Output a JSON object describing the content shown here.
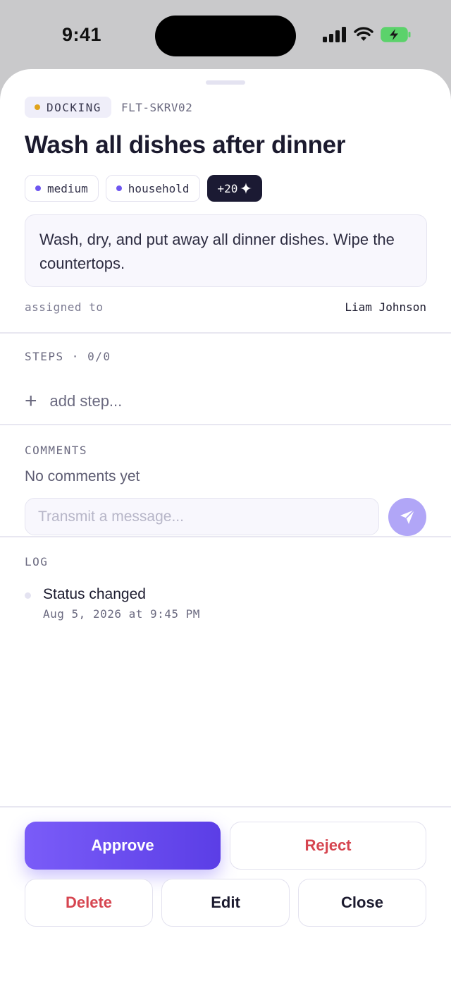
{
  "status_bar": {
    "time": "9:41"
  },
  "task": {
    "status": "DOCKING",
    "status_color": "#e0a31b",
    "id": "FLT-SKRV02",
    "title": "Wash all dishes after dinner",
    "tags": [
      {
        "label": "medium",
        "color": "#6e56f0"
      },
      {
        "label": "household",
        "color": "#6e56f0"
      }
    ],
    "points": "+20",
    "description": "Wash, dry, and put away all dinner dishes. Wipe the countertops.",
    "assigned_label": "assigned to",
    "assigned_value": "Liam Johnson"
  },
  "steps": {
    "label": "STEPS · 0/0",
    "add_label": "add step..."
  },
  "comments": {
    "label": "COMMENTS",
    "empty_text": "No comments yet",
    "input_placeholder": "Transmit a message..."
  },
  "log": {
    "label": "LOG",
    "entries": [
      {
        "text": "Status changed",
        "time": "Aug 5, 2026 at 9:45 PM"
      }
    ]
  },
  "actions": {
    "approve": "Approve",
    "reject": "Reject",
    "delete": "Delete",
    "edit": "Edit",
    "close": "Close"
  },
  "colors": {
    "accent": "#6e56f0",
    "danger": "#d64550",
    "send_button": "#b1a6f7"
  },
  "icons": {
    "signal": "cellular-signal-icon",
    "wifi": "wifi-icon",
    "battery": "battery-charging-icon",
    "sparkle": "sparkle-icon",
    "plus": "plus-icon",
    "send": "paper-plane-icon"
  }
}
